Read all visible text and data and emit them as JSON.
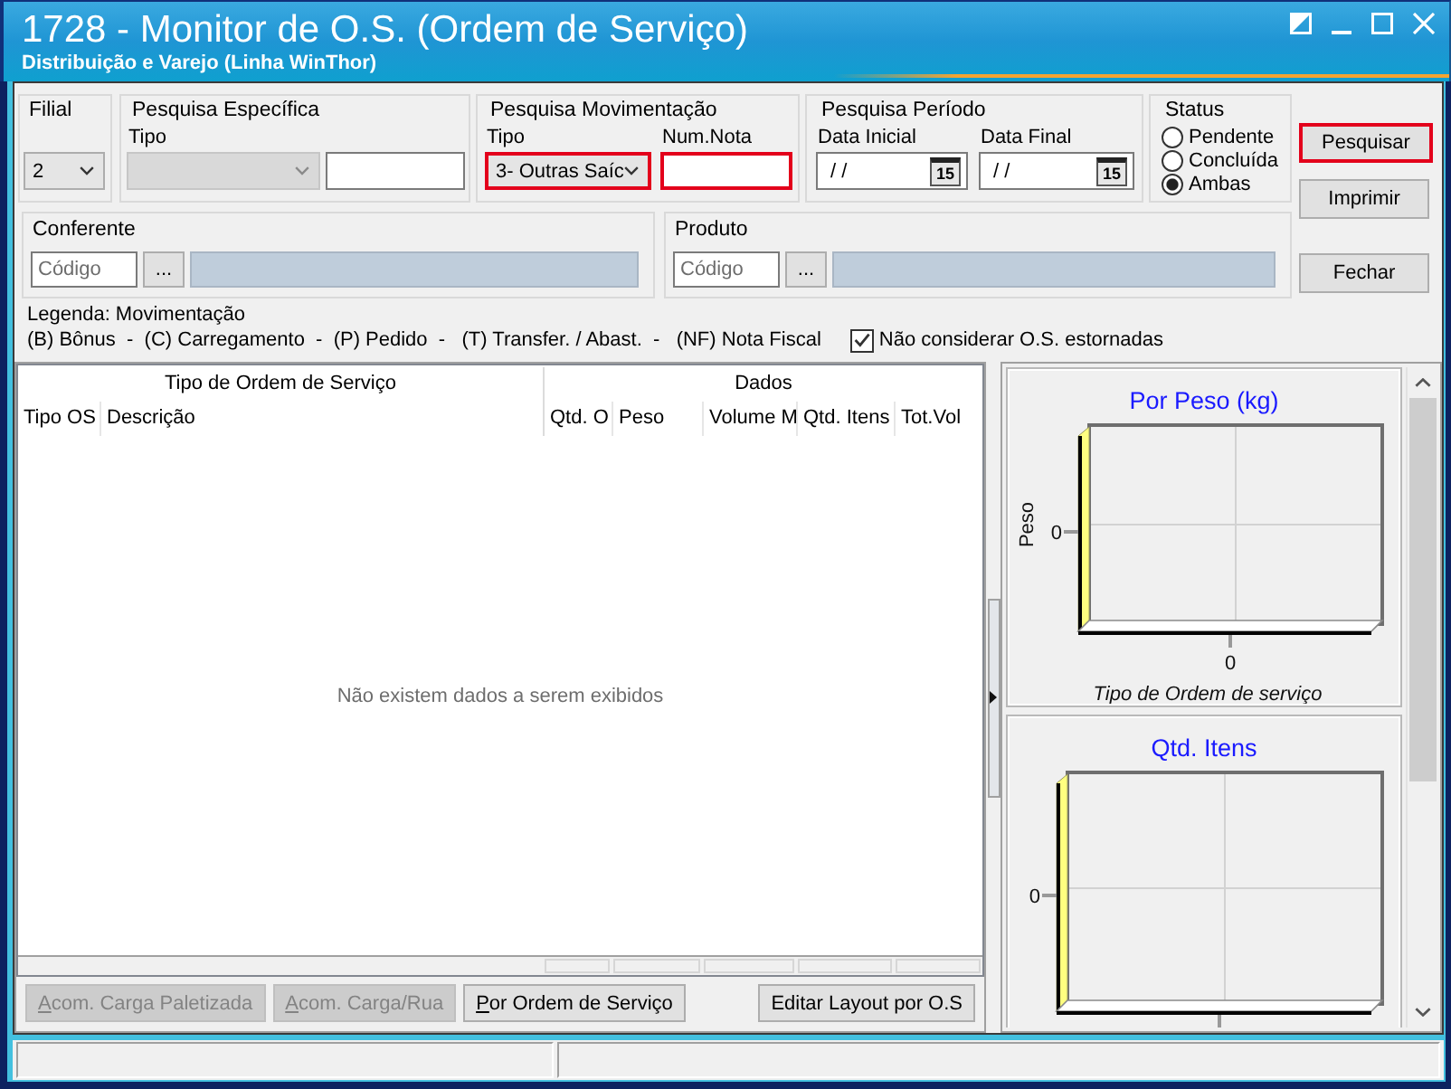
{
  "window": {
    "title": "1728 - Monitor de O.S. (Ordem de Serviço)",
    "subtitle": "Distribuição e Varejo (Linha WinThor)",
    "controls": [
      {
        "kind": "contrast"
      },
      {
        "kind": "minimize"
      },
      {
        "kind": "maximize"
      },
      {
        "kind": "close"
      }
    ]
  },
  "filter_groups": [
    {
      "title": "Filial",
      "fields": [
        {
          "kind": "combo",
          "value": "2",
          "disabled": false,
          "highlighted": false
        }
      ]
    },
    {
      "title": "Pesquisa Específica",
      "fields": [
        {
          "kind": "combo",
          "label": "Tipo",
          "disabled": true,
          "highlighted": false
        },
        {
          "kind": "text",
          "highlighted": false
        }
      ]
    },
    {
      "title": "Pesquisa Movimentação",
      "fields": [
        {
          "kind": "combo",
          "label": "Tipo",
          "value": "3- Outras Saíc",
          "disabled": false,
          "highlighted": true
        },
        {
          "kind": "text",
          "label": "Num.Nota",
          "highlighted": true
        }
      ]
    },
    {
      "title": "Pesquisa Período",
      "fields": [
        {
          "kind": "date",
          "label": "Data Inicial",
          "value": "/ /",
          "calendar": "15"
        },
        {
          "kind": "date",
          "label": "Data Final",
          "value": "/ /",
          "calendar": "15"
        }
      ]
    },
    {
      "title": "Status",
      "fields": [
        {
          "kind": "radio",
          "options": [
            {
              "label": "Pendente",
              "selected": false
            },
            {
              "label": "Concluída",
              "selected": false
            },
            {
              "label": "Ambas",
              "selected": true
            }
          ]
        }
      ]
    }
  ],
  "actions": [
    {
      "label": "Pesquisar",
      "highlighted": true
    },
    {
      "label": "Imprimir",
      "highlighted": false
    },
    {
      "label": "Fechar",
      "highlighted": false
    }
  ],
  "lookups": [
    {
      "title": "Conferente",
      "placeholder": "Código",
      "button": "..."
    },
    {
      "title": "Produto",
      "placeholder": "Código",
      "button": "..."
    }
  ],
  "legend": {
    "title": "Legenda: Movimentação",
    "text": "(B) Bônus  -  (C) Carregamento  -  (P) Pedido  -   (T) Transfer. / Abast.  -   (NF) Nota Fiscal"
  },
  "exclude_reversed": {
    "label": "Não considerar O.S. estornadas",
    "checked": true
  },
  "grid": {
    "column_groups": [
      {
        "label": "Tipo de Ordem de Serviço",
        "columns": [
          "Tipo OS",
          "Descrição"
        ]
      },
      {
        "label": "Dados",
        "columns": [
          "Qtd. O",
          "Peso",
          "Volume M",
          "Qtd. Itens",
          "Tot.Vol"
        ]
      }
    ],
    "empty_message": "Não existem dados a serem exibidos"
  },
  "grid_buttons": [
    {
      "label": "Acom. Carga Paletizada",
      "disabled": true,
      "mnemonic": true
    },
    {
      "label": "Acom. Carga/Rua",
      "disabled": true,
      "mnemonic": true
    },
    {
      "label": "Por Ordem de Serviço",
      "disabled": false,
      "mnemonic": true
    }
  ],
  "layout_button": {
    "label": "Editar Layout por O.S",
    "disabled": false,
    "mnemonic": false
  },
  "charts": [
    {
      "title": "Por Peso (kg)",
      "ylabel": "Peso",
      "ytick": "0",
      "xtick": "0",
      "xlabel": "Tipo de Ordem de serviço"
    },
    {
      "title": "Qtd. Itens",
      "ytick": "0"
    }
  ]
}
